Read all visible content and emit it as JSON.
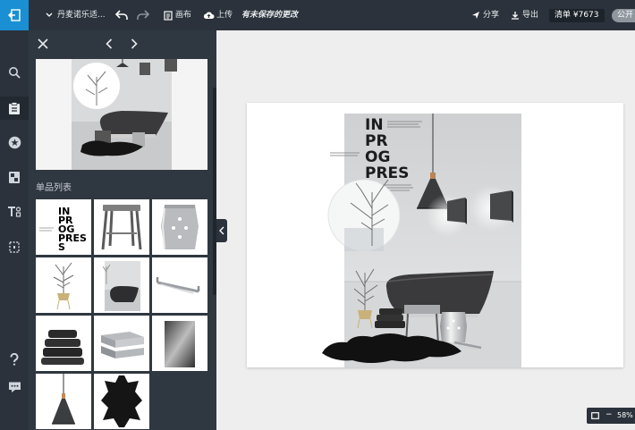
{
  "topbar": {
    "project_name": "丹麦诺乐适...",
    "canvas_label": "画布",
    "upload_label": "上传",
    "unsaved_notice": "有未保存的更改",
    "share_label": "分享",
    "export_label": "导出",
    "price_label": "清单 ¥7673",
    "public_label": "公开"
  },
  "panel": {
    "section_title": "单品列表"
  },
  "poster": {
    "headline_lines": [
      "IN",
      "PR",
      "OG",
      "PRES",
      "S"
    ],
    "tile_title_lines": [
      "IN",
      "PR",
      "OG",
      "PRES",
      "S"
    ]
  },
  "zoom": {
    "level": "58%",
    "minus": "−"
  },
  "colors": {
    "topbar_bg": "#2b323b",
    "accent_blue": "#1a8fd4",
    "panel_bg": "#2f3740",
    "workspace_bg": "#eeeeee"
  },
  "icons": {
    "nav": [
      "exit-icon",
      "search-icon",
      "clipboard-icon",
      "star-icon",
      "layers-icon",
      "text-icon",
      "crop-icon",
      "help-icon",
      "chat-icon"
    ]
  }
}
